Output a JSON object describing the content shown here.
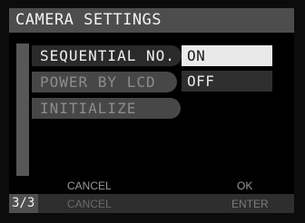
{
  "title": "CAMERA SETTINGS",
  "menu": {
    "items": [
      {
        "label": "SEQUENTIAL NO.",
        "state": "selected"
      },
      {
        "label": "POWER BY LCD",
        "state": "normal"
      },
      {
        "label": "INITIALIZE",
        "state": "normal"
      }
    ]
  },
  "options": {
    "items": [
      {
        "label": "ON",
        "state": "highlighted"
      },
      {
        "label": "OFF",
        "state": "normal"
      }
    ]
  },
  "footer": {
    "page": "3/3",
    "top_left": "CANCEL",
    "top_right": "OK",
    "bottom_left": "CANCEL",
    "bottom_right": "ENTER"
  },
  "colors": {
    "screen_bg": "#000000",
    "title_bar": "#4d4d4d",
    "highlight": "#e9e9e9",
    "menu_bg": "#474747"
  }
}
